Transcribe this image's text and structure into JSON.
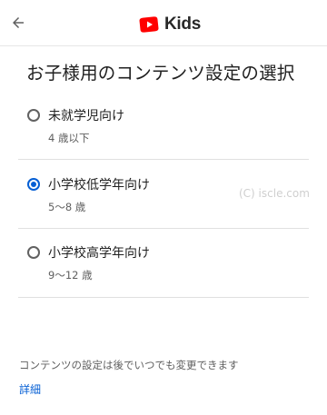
{
  "header": {
    "back_icon": "arrow-back-icon",
    "logo_icon": "youtube-play-icon",
    "logo_text": "Kids",
    "colors": {
      "logo_red": "#ff0000"
    }
  },
  "title": "お子様用のコンテンツ設定の選択",
  "options": [
    {
      "label": "未就学児向け",
      "age": "4 歳以下",
      "selected": false
    },
    {
      "label": "小学校低学年向け",
      "age": "5〜8 歳",
      "selected": true
    },
    {
      "label": "小学校高学年向け",
      "age": "9〜12 歳",
      "selected": false
    }
  ],
  "watermark": "(C) iscle.com",
  "footer": {
    "note": "コンテンツの設定は後でいつでも変更できます",
    "link": "詳細"
  },
  "colors": {
    "accent": "#065fd4"
  }
}
